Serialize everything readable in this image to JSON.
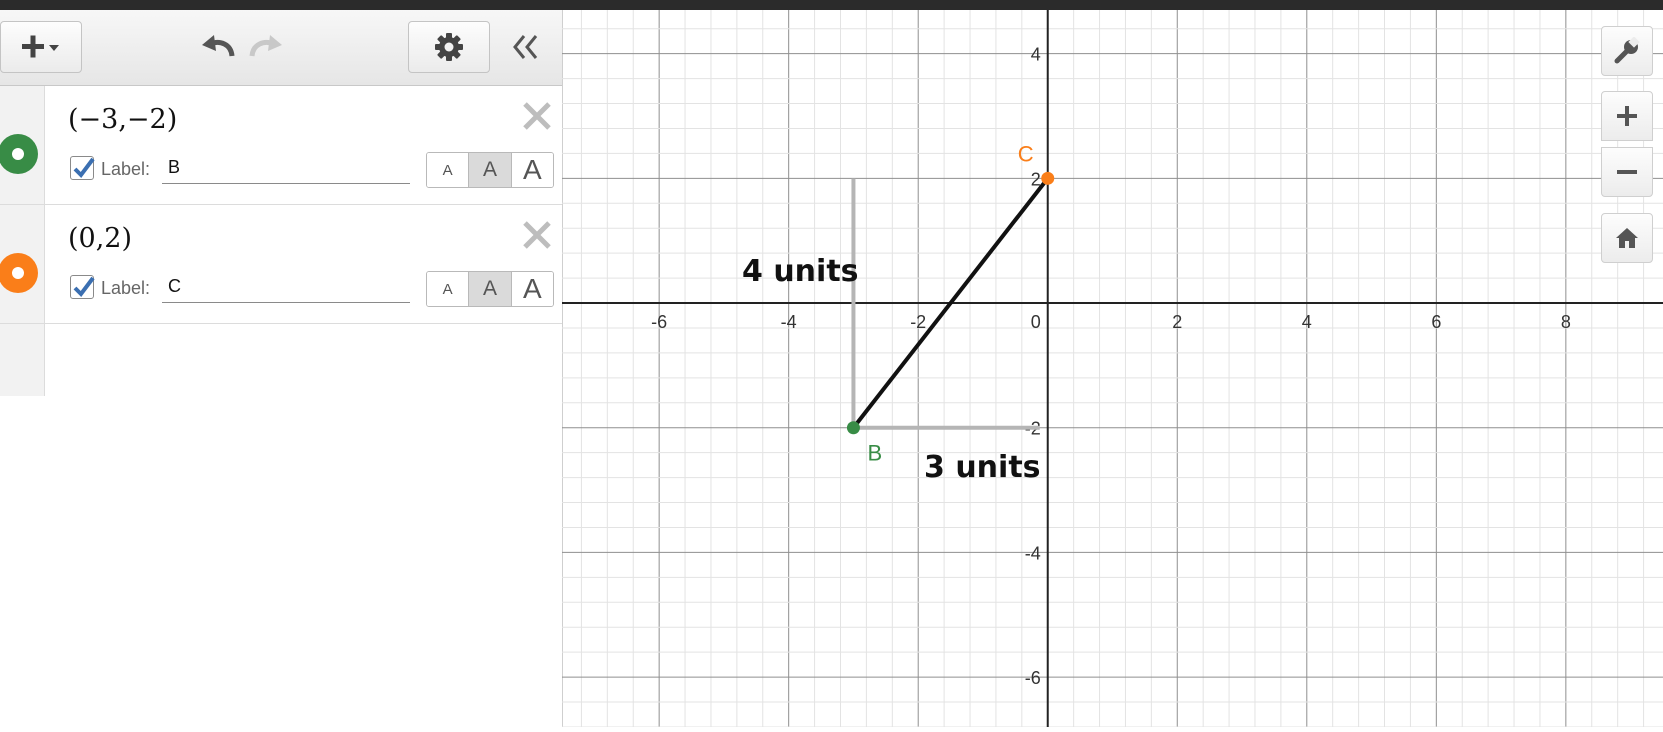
{
  "toolbar": {
    "add_icon": "plus-dropdown-icon",
    "undo_icon": "undo-icon",
    "redo_icon": "redo-icon",
    "settings_icon": "gear-icon",
    "collapse_icon": "double-chevron-left-icon"
  },
  "expressions": [
    {
      "latex": "(−3,−2)",
      "color": "#388c46",
      "label_checkbox_text": "Label:",
      "label_value": "B",
      "label_checked": true,
      "size_options": [
        "A",
        "A",
        "A"
      ],
      "selected_size_index": 1
    },
    {
      "latex": "(0,2)",
      "color": "#fa7e19",
      "label_checkbox_text": "Label:",
      "label_value": "C",
      "label_checked": true,
      "size_options": [
        "A",
        "A",
        "A"
      ],
      "selected_size_index": 1
    }
  ],
  "graph_controls": {
    "wrench_icon": "wrench-icon",
    "zoom_in_icon": "plus-icon",
    "zoom_out_icon": "minus-icon",
    "home_icon": "home-icon"
  },
  "graph": {
    "x_range": [
      -7.5,
      9.5
    ],
    "y_range": [
      -6.8,
      4.7
    ],
    "x_ticks": [
      "-6",
      "-4",
      "-2",
      "2",
      "4",
      "6",
      "8"
    ],
    "y_ticks": [
      "4",
      "2",
      "-2",
      "-4",
      "-6"
    ],
    "x_tick_values": [
      -6,
      -4,
      -2,
      2,
      4,
      6,
      8
    ],
    "y_tick_values": [
      4,
      2,
      -2,
      -4,
      -6
    ],
    "origin_label": "0",
    "minor_grid_step": 0.4,
    "major_grid_step": 2,
    "points": [
      {
        "name": "B",
        "x": -3,
        "y": -2,
        "color": "#388c46"
      },
      {
        "name": "C",
        "x": 0,
        "y": 2,
        "color": "#fa7e19"
      }
    ],
    "annotations": {
      "vertical_leg": "4 units",
      "horizontal_leg": "3 units"
    },
    "segment_color": "#111111",
    "leg_color": "#b5b5b5"
  }
}
